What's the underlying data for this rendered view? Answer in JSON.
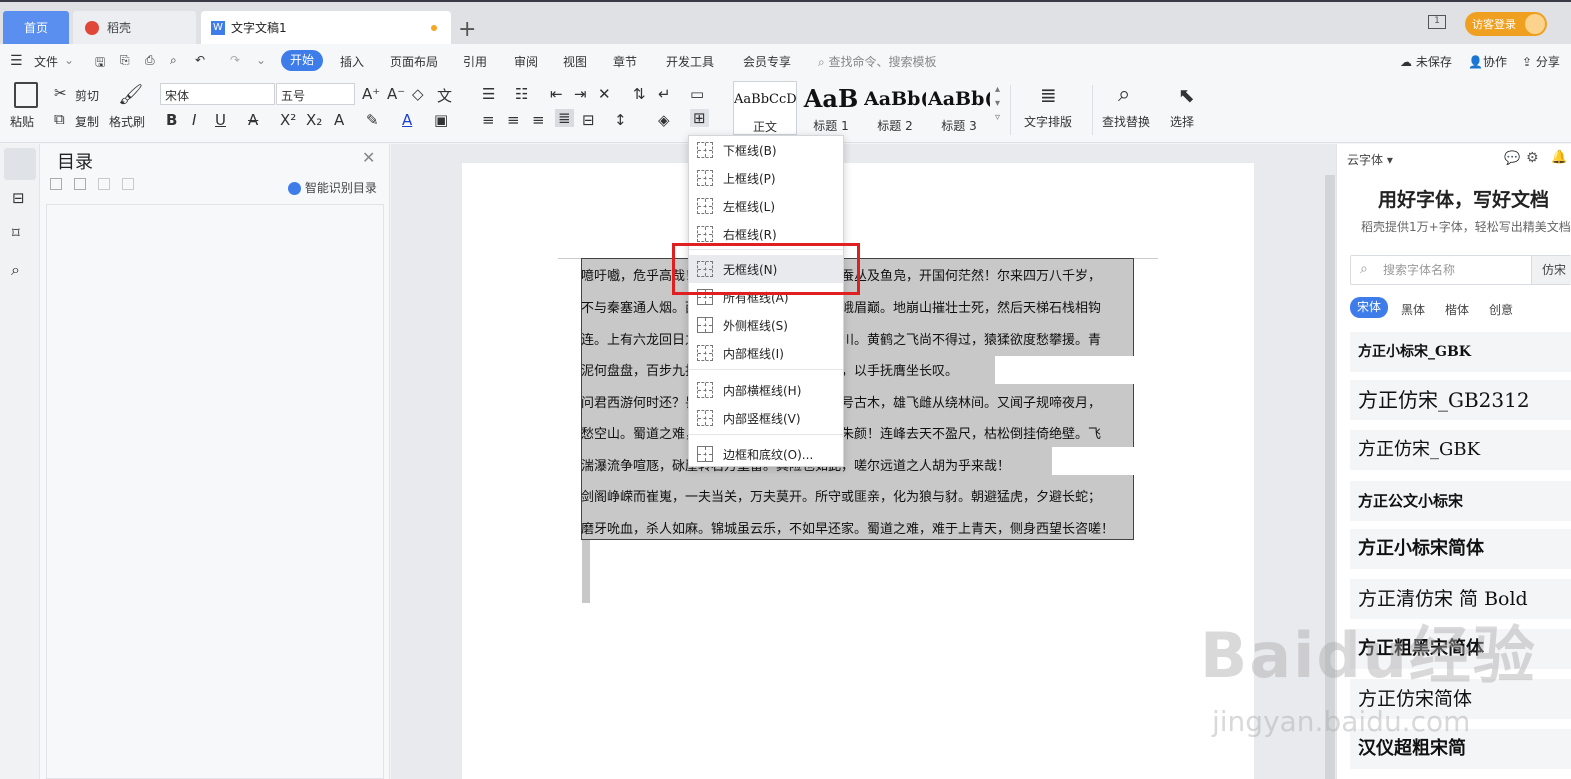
{
  "tabs": {
    "home": "首页",
    "daoke": "稻壳",
    "doc": "文字文稿1",
    "add": "+"
  },
  "titlebar": {
    "screen_badge": "1",
    "login": "访客登录"
  },
  "menu": {
    "file": "文件",
    "items": [
      "开始",
      "插入",
      "页面布局",
      "引用",
      "审阅",
      "视图",
      "章节",
      "开发工具",
      "会员专享"
    ],
    "search": "查找命令、搜索模板",
    "unsaved": "未保存",
    "collab": "协作",
    "share": "分享"
  },
  "ribbon": {
    "paste": "粘贴",
    "cut": "剪切",
    "copy": "复制",
    "format_painter": "格式刷",
    "font_name": "宋体",
    "font_size": "五号",
    "styles": [
      {
        "sample": "AaBbCcD",
        "name": "正文"
      },
      {
        "sample": "AaB",
        "name": "标题 1"
      },
      {
        "sample": "AaBb(",
        "name": "标题 2"
      },
      {
        "sample": "AaBb(",
        "name": "标题 3"
      }
    ],
    "text_layout": "文字排版",
    "find_replace": "查找替换",
    "select": "选择"
  },
  "toc": {
    "title": "目录",
    "smart": "智能识别目录"
  },
  "document": {
    "lines": [
      "噫吁嚱，危乎高哉！蜀道之难，难于上青天！蚕丛及鱼凫，开国何茫然！尔来四万八千岁，",
      "不与秦塞通人烟。西当太白有鸟道，可以横绝峨眉巅。地崩山摧壮士死，然后天梯石栈相钩",
      "连。上有六龙回日之高标，下有冲波逆折之回川。黄鹤之飞尚不得过，猿猱欲度愁攀援。青",
      "泥何盘盘，百步九折萦岩峦。扪参历井仰胁息，以手抚膺坐长叹。",
      "问君西游何时还？畏途巉岩不可攀。但见悲鸟号古木，雄飞雌从绕林间。又闻子规啼夜月，",
      "愁空山。蜀道之难，难于上青天，使人听此凋朱颜！连峰去天不盈尺，枯松倒挂倚绝壁。飞",
      "湍瀑流争喧豗，砯崖转石万壑雷。其险也如此，嗟尔远道之人胡为乎来哉！",
      "剑阁峥嵘而崔嵬，一夫当关，万夫莫开。所守或匪亲，化为狼与豺。朝避猛虎，夕避长蛇；",
      "磨牙吮血，杀人如麻。锦城虽云乐，不如早还家。蜀道之难，难于上青天，侧身西望长咨嗟！"
    ]
  },
  "border_menu": {
    "items": [
      "下框线(B)",
      "上框线(P)",
      "左框线(L)",
      "右框线(R)",
      "无框线(N)",
      "所有框线(A)",
      "外侧框线(S)",
      "内部框线(I)",
      "内部横框线(H)",
      "内部竖框线(V)",
      "边框和底纹(O)..."
    ]
  },
  "font_panel": {
    "cloud": "云字体",
    "heading": "用好字体，写好文档",
    "subtitle": "稻壳提供1万+字体，轻松写出精美文档",
    "search_placeholder": "搜索字体名称",
    "search_btn": "仿宋",
    "tabs": [
      "宋体",
      "黑体",
      "楷体",
      "创意"
    ],
    "fonts": [
      "方正小标宋_GBK",
      "方正仿宋_GB2312",
      "方正仿宋_GBK",
      "方正公文小标宋",
      "方正小标宋简体",
      "方正清仿宋 简 Bold",
      "方正粗黑宋简体",
      "方正仿宋简体",
      "汉仪超粗宋简"
    ]
  },
  "watermark": {
    "brand": "Baidu经验",
    "url": "jingyan.baidu.com"
  }
}
